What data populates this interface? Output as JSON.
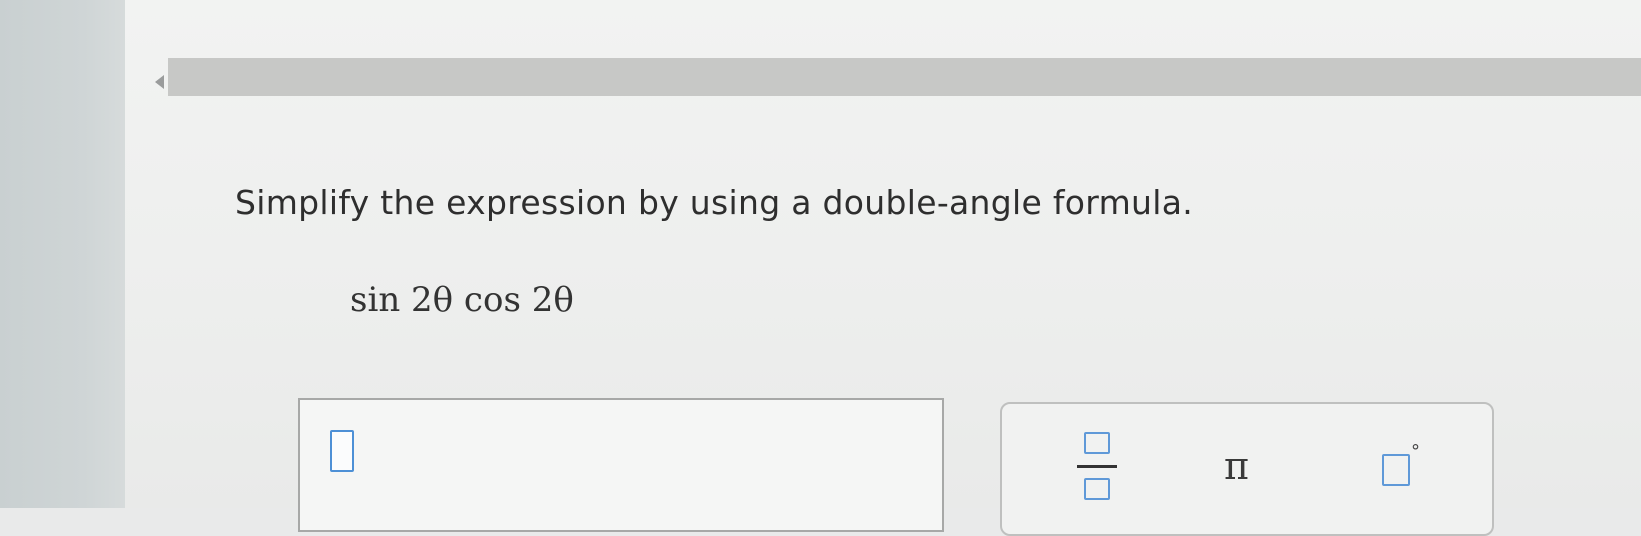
{
  "question": {
    "prompt": "Simplify the expression by using a double-angle formula.",
    "expression": "sin 2θ cos 2θ"
  },
  "answer": {
    "value": ""
  },
  "toolbox": {
    "pi_label": "π",
    "degree_symbol": "°"
  },
  "colors": {
    "nav_green": "#67b94a",
    "input_accent": "#4d90d6"
  }
}
